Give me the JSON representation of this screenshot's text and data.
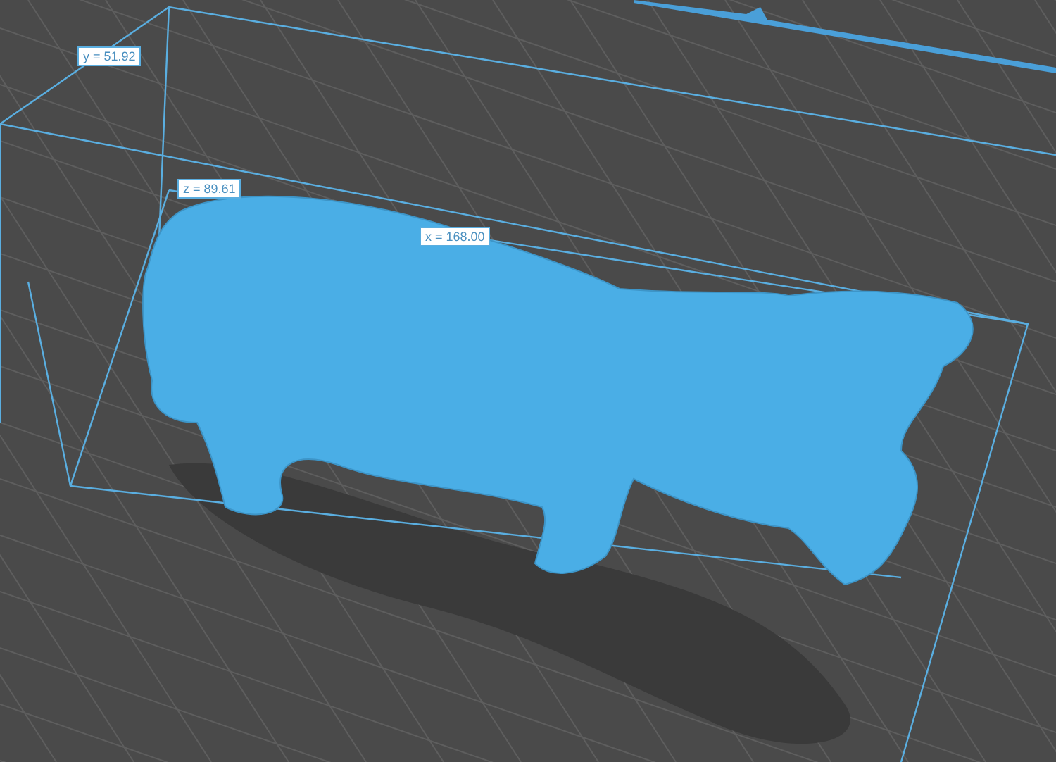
{
  "dimension_labels": [
    {
      "text": "y = 51.92"
    },
    {
      "text": "z = 89.61"
    },
    {
      "text": "x = 168.00"
    }
  ]
}
